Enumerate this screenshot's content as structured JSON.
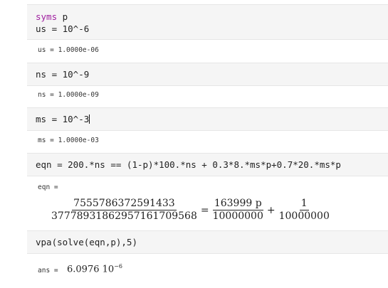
{
  "cells": [
    {
      "lines": [
        "us = 10^-6"
      ],
      "keyword": "syms",
      "keyword_arg": " p",
      "output": "us = 1.0000e-06"
    },
    {
      "lines": [
        "ns = 10^-9"
      ],
      "output": "ns = 1.0000e-09"
    },
    {
      "lines": [
        "ms = 10^-3"
      ],
      "output": "ms = 1.0000e-03"
    },
    {
      "lines": [
        "eqn = 200.*ns == (1-p)*100.*ns + 0.3*8.*ms*p+0.7*20.*ms*p"
      ],
      "output": "eqn ="
    },
    {
      "lines": [
        "vpa(solve(eqn,p),5)"
      ],
      "output": "ans ="
    }
  ],
  "eqn_display": {
    "lhs_num": "7555786372591433",
    "lhs_den": "37778931862957161709568",
    "equals": "=",
    "t1_num": "163999 p",
    "t1_den": "10000000",
    "plus": "+",
    "t2_num": "1",
    "t2_den": "10000000"
  },
  "ans_display": {
    "mantissa": "6.0976 10",
    "exponent": "−6"
  }
}
